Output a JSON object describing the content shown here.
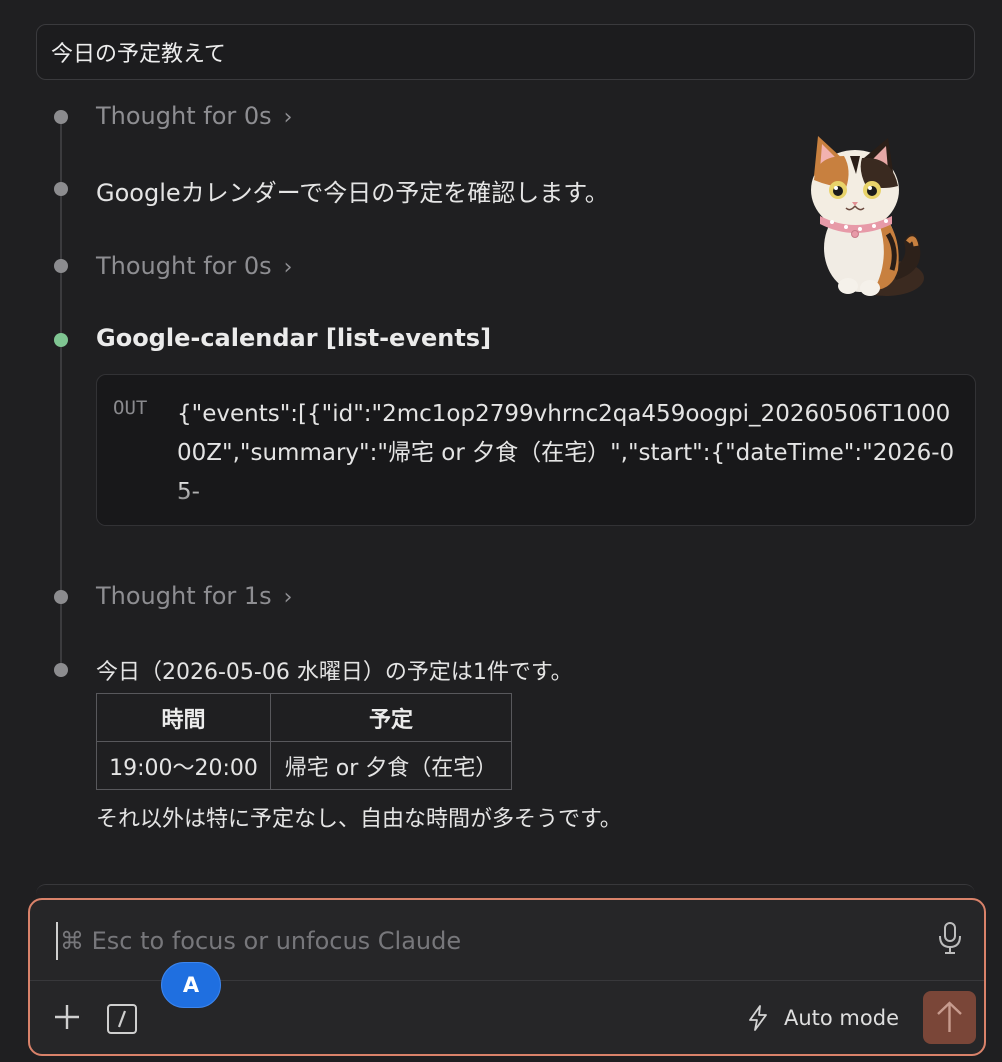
{
  "user_message": "今日の予定教えて",
  "timeline": {
    "thought_1": "Thought for 0s",
    "assistant_intro": "Googleカレンダーで今日の予定を確認します。",
    "thought_2": "Thought for 0s",
    "tool_call": {
      "title": "Google-calendar [list-events]",
      "out_label": "OUT",
      "out_text": "{\"events\":[{\"id\":\"2mc1op2799vhrnc2qa459oogpi_20260506T100000Z\",\"summary\":\"帰宅 or 夕食（在宅）\",\"start\":{\"dateTime\":\"2026-05-"
    },
    "thought_3": "Thought for 1s",
    "answer": {
      "intro": "今日（2026-05-06 水曜日）の予定は1件です。",
      "table": {
        "headers": [
          "時間",
          "予定"
        ],
        "rows": [
          [
            "19:00〜20:00",
            "帰宅 or 夕食（在宅）"
          ]
        ]
      },
      "outro": "それ以外は特に予定なし、自由な時間が多そうです。"
    }
  },
  "composer": {
    "placeholder": "⌘ Esc to focus or unfocus Claude",
    "avatar_letter": "A",
    "mode_label": "Auto mode"
  },
  "colors": {
    "accent_border": "#d9826a",
    "send_button": "#7a4638",
    "tool_dot": "#7fc592",
    "avatar_bg": "#1f6fe0"
  },
  "icons": [
    "chevron-right-icon",
    "microphone-icon",
    "plus-icon",
    "slash-command-icon",
    "lightning-icon",
    "arrow-up-icon",
    "cat-sticker"
  ]
}
